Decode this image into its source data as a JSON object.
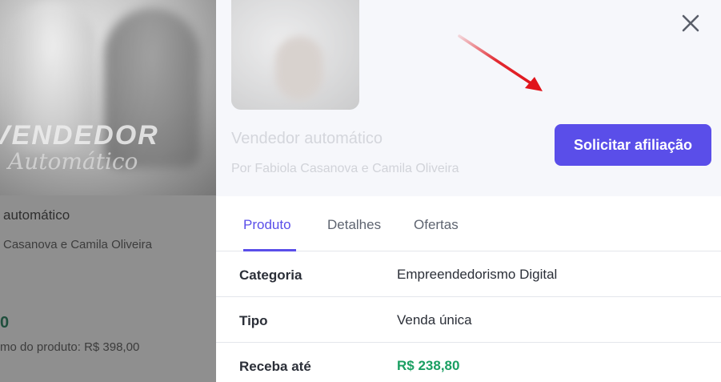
{
  "background_card": {
    "cover_text": "VENDEDOR",
    "cover_script": "Automático",
    "title": "automático",
    "author": "Casanova e Camila Oliveira",
    "price": "0",
    "max_price": "mo do produto: R$ 398,00"
  },
  "panel": {
    "product_title": "Vendedor automático",
    "product_author": "Por Fabiola Casanova e Camila Oliveira",
    "cta_label": "Solicitar afiliação",
    "colors": {
      "accent": "#5a4ee9",
      "money": "#1a9f62",
      "arrow": "#e0141b"
    }
  },
  "tabs": [
    {
      "label": "Produto",
      "active": true
    },
    {
      "label": "Detalhes",
      "active": false
    },
    {
      "label": "Ofertas",
      "active": false
    }
  ],
  "details": [
    {
      "label": "Categoria",
      "value": "Empreendedorismo Digital"
    },
    {
      "label": "Tipo",
      "value": "Venda única"
    },
    {
      "label": "Receba até",
      "value": "R$ 238,80"
    }
  ],
  "icons": {
    "close": "close-icon",
    "arrow": "arrow-annotation-icon"
  }
}
